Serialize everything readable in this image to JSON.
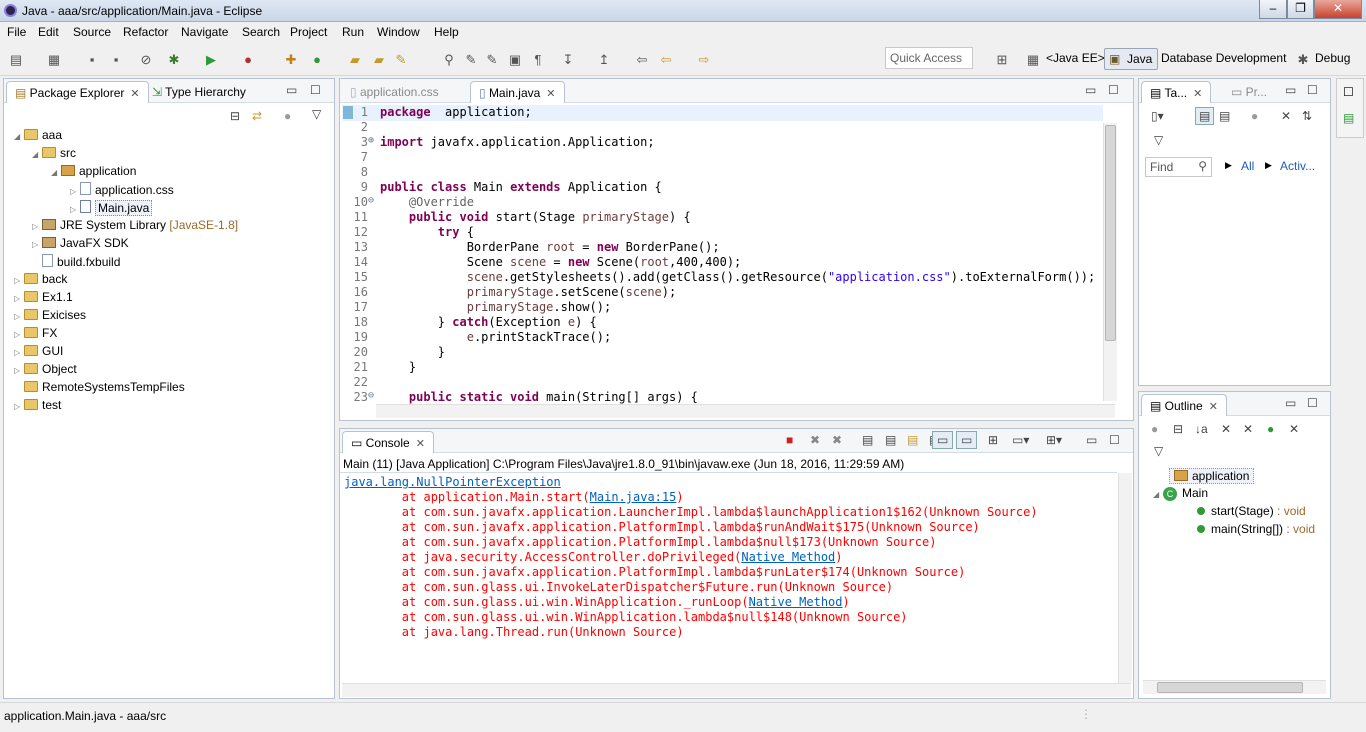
{
  "window": {
    "title": "Java - aaa/src/application/Main.java - Eclipse",
    "min": "–",
    "max": "❐",
    "close": "✕"
  },
  "menu": [
    "File",
    "Edit",
    "Source",
    "Refactor",
    "Navigate",
    "Search",
    "Project",
    "Run",
    "Window",
    "Help"
  ],
  "toolbar": {
    "quick_access": "Quick Access"
  },
  "perspectives": {
    "java_ee": "<Java EE>",
    "java": "Java",
    "database": "Database Development",
    "debug": "Debug"
  },
  "package_explorer": {
    "tabs": [
      "Package Explorer",
      "Type Hierarchy"
    ],
    "tree": [
      {
        "label": "aaa",
        "extra": ""
      },
      {
        "label": "src",
        "extra": ""
      },
      {
        "label": "application",
        "extra": ""
      },
      {
        "label": "application.css",
        "extra": ""
      },
      {
        "label": "Main.java",
        "extra": ""
      },
      {
        "label": "JRE System Library",
        "extra": "[JavaSE-1.8]"
      },
      {
        "label": "JavaFX SDK",
        "extra": ""
      },
      {
        "label": "build.fxbuild",
        "extra": ""
      },
      {
        "label": "back",
        "extra": ""
      },
      {
        "label": "Ex1.1",
        "extra": ""
      },
      {
        "label": "Exicises",
        "extra": ""
      },
      {
        "label": "FX",
        "extra": ""
      },
      {
        "label": "GUI",
        "extra": ""
      },
      {
        "label": "Object",
        "extra": ""
      },
      {
        "label": "RemoteSystemsTempFiles",
        "extra": ""
      },
      {
        "label": "test",
        "extra": ""
      }
    ]
  },
  "editor": {
    "tabs": [
      "application.css",
      "Main.java"
    ],
    "lines": [
      {
        "n": "1",
        "m": "",
        "t": [
          [
            "kw",
            "package"
          ],
          [
            "",
            "  application;"
          ]
        ]
      },
      {
        "n": "2",
        "m": "",
        "t": []
      },
      {
        "n": "3",
        "m": "⊕",
        "t": [
          [
            "kw",
            "import"
          ],
          [
            "",
            " javafx.application.Application;"
          ]
        ]
      },
      {
        "n": "7",
        "m": "",
        "t": []
      },
      {
        "n": "8",
        "m": "",
        "t": []
      },
      {
        "n": "9",
        "m": "",
        "t": [
          [
            "kw",
            "public class"
          ],
          [
            "",
            " Main "
          ],
          [
            "kw",
            "extends"
          ],
          [
            "",
            " Application {"
          ]
        ]
      },
      {
        "n": "10",
        "m": "⊖",
        "t": [
          [
            "",
            "    "
          ],
          [
            "ann",
            "@Override"
          ]
        ]
      },
      {
        "n": "11",
        "m": "",
        "t": [
          [
            "",
            "    "
          ],
          [
            "kw",
            "public void"
          ],
          [
            "",
            " start(Stage "
          ],
          [
            "var",
            "primaryStage"
          ],
          [
            "",
            ") {"
          ]
        ]
      },
      {
        "n": "12",
        "m": "",
        "t": [
          [
            "",
            "        "
          ],
          [
            "kw",
            "try"
          ],
          [
            "",
            " {"
          ]
        ]
      },
      {
        "n": "13",
        "m": "",
        "t": [
          [
            "",
            "            BorderPane "
          ],
          [
            "var",
            "root"
          ],
          [
            "",
            " = "
          ],
          [
            "kw",
            "new"
          ],
          [
            "",
            " BorderPane();"
          ]
        ]
      },
      {
        "n": "14",
        "m": "",
        "t": [
          [
            "",
            "            Scene "
          ],
          [
            "var",
            "scene"
          ],
          [
            "",
            " = "
          ],
          [
            "kw",
            "new"
          ],
          [
            "",
            " Scene("
          ],
          [
            "var",
            "root"
          ],
          [
            "",
            ",400,400);"
          ]
        ]
      },
      {
        "n": "15",
        "m": "",
        "t": [
          [
            "",
            "            "
          ],
          [
            "var",
            "scene"
          ],
          [
            "",
            ".getStylesheets().add(getClass().getResource("
          ],
          [
            "str",
            "\"application.css\""
          ],
          [
            "",
            ").toExternalForm());"
          ]
        ]
      },
      {
        "n": "16",
        "m": "",
        "t": [
          [
            "",
            "            "
          ],
          [
            "var",
            "primaryStage"
          ],
          [
            "",
            ".setScene("
          ],
          [
            "var",
            "scene"
          ],
          [
            "",
            ");"
          ]
        ]
      },
      {
        "n": "17",
        "m": "",
        "t": [
          [
            "",
            "            "
          ],
          [
            "var",
            "primaryStage"
          ],
          [
            "",
            ".show();"
          ]
        ]
      },
      {
        "n": "18",
        "m": "",
        "t": [
          [
            "",
            "        } "
          ],
          [
            "kw",
            "catch"
          ],
          [
            "",
            "(Exception "
          ],
          [
            "var",
            "e"
          ],
          [
            "",
            ") {"
          ]
        ]
      },
      {
        "n": "19",
        "m": "",
        "t": [
          [
            "",
            "            "
          ],
          [
            "var",
            "e"
          ],
          [
            "",
            ".printStackTrace();"
          ]
        ]
      },
      {
        "n": "20",
        "m": "",
        "t": [
          [
            "",
            "        }"
          ]
        ]
      },
      {
        "n": "21",
        "m": "",
        "t": [
          [
            "",
            "    }"
          ]
        ]
      },
      {
        "n": "22",
        "m": "",
        "t": []
      },
      {
        "n": "23",
        "m": "⊖",
        "t": [
          [
            "",
            "    "
          ],
          [
            "kw",
            "public static void"
          ],
          [
            "",
            " main(String[] args) {"
          ]
        ]
      }
    ]
  },
  "console": {
    "tab": "Console",
    "header": "Main (11) [Java Application] C:\\Program Files\\Java\\jre1.8.0_91\\bin\\javaw.exe (Jun 18, 2016, 11:29:59 AM)",
    "lines": [
      [
        [
          "link",
          "java.lang.NullPointerException"
        ]
      ],
      [
        [
          "",
          "\tat application.Main.start("
        ],
        [
          "link",
          "Main.java:15"
        ],
        [
          "",
          ")"
        ]
      ],
      [
        [
          "",
          "\tat com.sun.javafx.application.LauncherImpl.lambda$launchApplication1$162(Unknown Source)"
        ]
      ],
      [
        [
          "",
          "\tat com.sun.javafx.application.PlatformImpl.lambda$runAndWait$175(Unknown Source)"
        ]
      ],
      [
        [
          "",
          "\tat com.sun.javafx.application.PlatformImpl.lambda$null$173(Unknown Source)"
        ]
      ],
      [
        [
          "",
          "\tat java.security.AccessController.doPrivileged("
        ],
        [
          "link",
          "Native Method"
        ],
        [
          "",
          ")"
        ]
      ],
      [
        [
          "",
          "\tat com.sun.javafx.application.PlatformImpl.lambda$runLater$174(Unknown Source)"
        ]
      ],
      [
        [
          "",
          "\tat com.sun.glass.ui.InvokeLaterDispatcher$Future.run(Unknown Source)"
        ]
      ],
      [
        [
          "",
          "\tat com.sun.glass.ui.win.WinApplication._runLoop("
        ],
        [
          "link",
          "Native Method"
        ],
        [
          "",
          ")"
        ]
      ],
      [
        [
          "",
          "\tat com.sun.glass.ui.win.WinApplication.lambda$null$148(Unknown Source)"
        ]
      ],
      [
        [
          "",
          "\tat java.lang.Thread.run(Unknown Source)"
        ]
      ]
    ]
  },
  "task_panel": {
    "tabs": [
      "Ta...",
      "Pr..."
    ],
    "find_placeholder": "Find",
    "all": "All",
    "activ": "Activ..."
  },
  "outline": {
    "tab": "Outline",
    "items": [
      {
        "label": "application",
        "type": ""
      },
      {
        "label": "Main",
        "type": ""
      },
      {
        "label": "start(Stage)",
        "type": " : void"
      },
      {
        "label": "main(String[])",
        "type": " : void"
      }
    ]
  },
  "status": "application.Main.java - aaa/src",
  "colors": {
    "keyword": "#7f0055",
    "error": "#ff0000",
    "link": "#0060c0",
    "string": "#2a00ff"
  }
}
